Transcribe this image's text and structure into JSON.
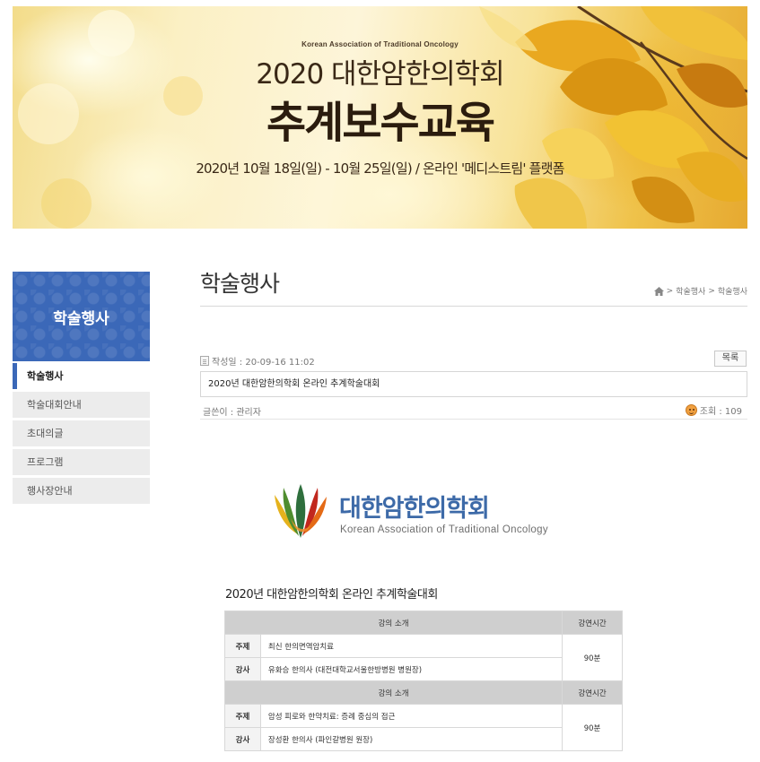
{
  "banner": {
    "org_en": "Korean Association of Traditional Oncology",
    "title_line1": "2020 대한암한의학회",
    "title_line2": "추계보수교육",
    "date_line": "2020년 10월 18일(일) - 10월 25일(일) / 온라인 '메디스트림' 플랫폼"
  },
  "sidebar": {
    "heading": "학술행사",
    "items": [
      {
        "label": "학술행사",
        "active": true
      },
      {
        "label": "학술대회안내",
        "active": false
      },
      {
        "label": "초대의글",
        "active": false
      },
      {
        "label": "프로그램",
        "active": false
      },
      {
        "label": "행사장안내",
        "active": false
      }
    ]
  },
  "header": {
    "page_title": "학술행사",
    "breadcrumb": [
      "학술행사",
      "학술행사"
    ],
    "breadcrumb_separator": ">"
  },
  "post": {
    "date_label": "작성일 : 20-09-16 11:02",
    "list_button": "목록",
    "title": "2020년 대한암한의학회 온라인 추계학술대회",
    "author_label": "글쓴이 : 관리자",
    "views_label": "조회 : 109"
  },
  "org_logo": {
    "name_ko": "대한암한의학회",
    "name_en": "Korean Association of Traditional Oncology"
  },
  "program": {
    "title": "2020년 대한암한의학회 온라인 추계학술대회",
    "header": {
      "intro": "강의 소개",
      "duration": "강연시간"
    },
    "sessions": [
      {
        "topic_label": "주제",
        "topic": "최신 한의면역암치료",
        "lecturer_label": "강사",
        "lecturer": "유화승 한의사 (대전대학교서울한방병원 병원장)",
        "duration": "90분"
      },
      {
        "topic_label": "주제",
        "topic": "암성 피로와 한약치료: 증례 중심의 접근",
        "lecturer_label": "강사",
        "lecturer": "장성환 한의사 (파인갈병원 원장)",
        "duration": "90분"
      }
    ]
  },
  "colors": {
    "accent": "#3b68b8",
    "sidebar_item_bg": "#ececec",
    "table_header_bg": "#cfcfcf",
    "logo_text": "#3d6aa8"
  }
}
